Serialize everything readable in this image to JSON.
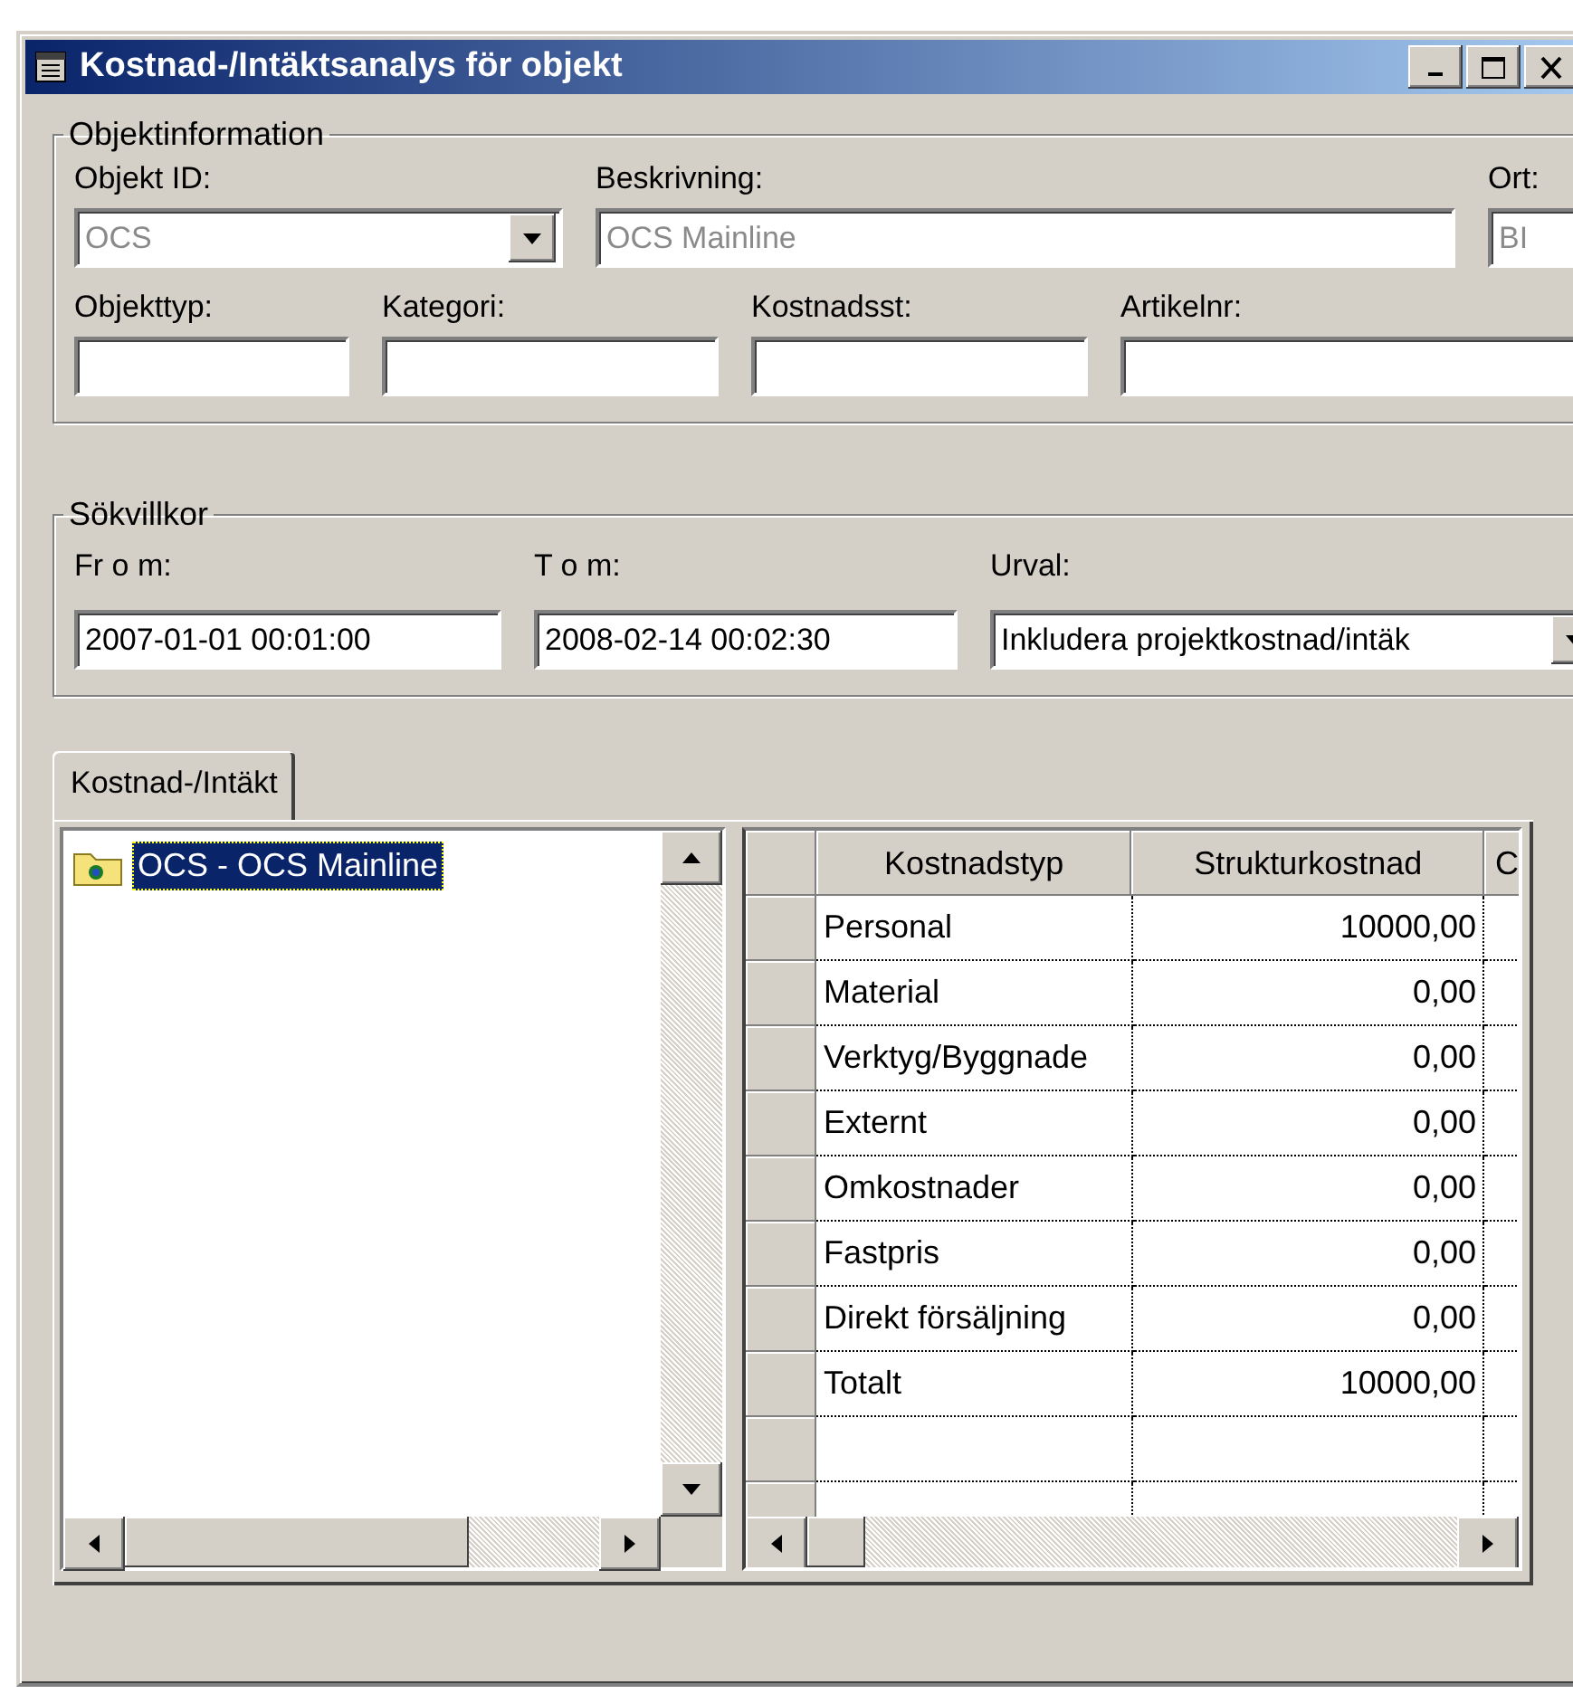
{
  "window": {
    "title": "Kostnad-/Intäktsanalys för objekt"
  },
  "objektinformation": {
    "legend": "Objektinformation",
    "fields": [
      {
        "label": "Objekt ID:",
        "value": "OCS",
        "kind": "combo",
        "disabled": true
      },
      {
        "label": "Beskrivning:",
        "value": "OCS Mainline",
        "kind": "text",
        "disabled": true
      },
      {
        "label": "Ort:",
        "value": "BI",
        "kind": "text",
        "disabled": true
      },
      {
        "label": "Objekttyp:",
        "kind": "text"
      },
      {
        "label": "Kategori:",
        "kind": "text"
      },
      {
        "label": "Kostnadsst:",
        "kind": "text"
      },
      {
        "label": "Artikelnr:",
        "kind": "text"
      }
    ]
  },
  "sokvillkor": {
    "legend": "Sökvillkor",
    "fields": [
      {
        "label": "Fr o m:",
        "value": "2007-01-01 00:01:00",
        "kind": "text",
        "disabled": false
      },
      {
        "label": "T o m:",
        "value": "2008-02-14 00:02:30",
        "kind": "text",
        "disabled": false
      },
      {
        "label": "Urval:",
        "value": "Inkludera projektkostnad/intäk",
        "kind": "combo",
        "disabled": false
      }
    ]
  },
  "tabs": [
    {
      "label": "Kostnad-/Intäkt",
      "selected": true
    }
  ],
  "tree": {
    "items": [
      {
        "label": "OCS - OCS Mainline",
        "selected": true
      }
    ]
  },
  "table": {
    "columns": [
      "Kostnadstyp",
      "Strukturkostnad",
      "C"
    ],
    "rows": [
      [
        "Personal",
        "10000,00"
      ],
      [
        "Material",
        "0,00"
      ],
      [
        "Verktyg/Byggnade",
        "0,00"
      ],
      [
        "Externt",
        "0,00"
      ],
      [
        "Omkostnader",
        "0,00"
      ],
      [
        "Fastpris",
        "0,00"
      ],
      [
        "Direkt försäljning",
        "0,00"
      ],
      [
        "Totalt",
        "10000,00"
      ]
    ]
  }
}
